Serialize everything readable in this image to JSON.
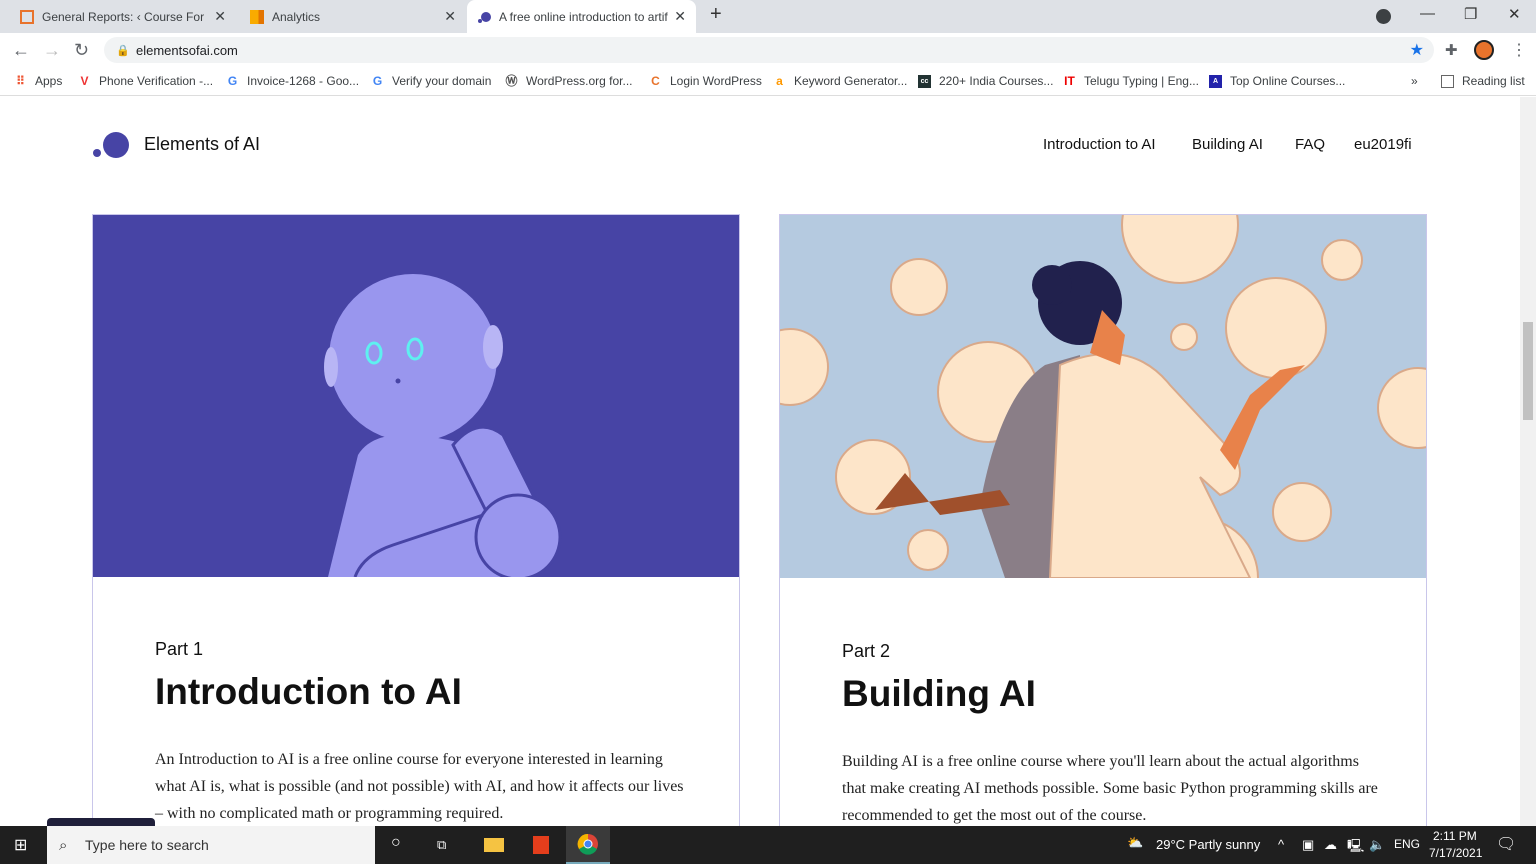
{
  "browser": {
    "tabs": [
      {
        "title": "General Reports: ‹ Course For Futu",
        "icon": "course-favicon"
      },
      {
        "title": "Analytics",
        "icon": "analytics-favicon"
      },
      {
        "title": "A free online introduction to artificial",
        "icon": "elements-favicon",
        "active": true
      }
    ],
    "url": "elementsofai.com",
    "bookmarks": [
      {
        "label": "Apps",
        "icon": "apps-grid-icon"
      },
      {
        "label": "Phone Verification -...",
        "icon": "v-icon"
      },
      {
        "label": "Invoice-1268 - Goo...",
        "icon": "google-icon"
      },
      {
        "label": "Verify your domain",
        "icon": "google-icon"
      },
      {
        "label": "WordPress.org for...",
        "icon": "wordpress-icon"
      },
      {
        "label": "Login WordPress",
        "icon": "course-favicon"
      },
      {
        "label": "Keyword Generator...",
        "icon": "amazon-icon"
      },
      {
        "label": "220+ India Courses...",
        "icon": "cc-icon"
      },
      {
        "label": "Telugu Typing | Eng...",
        "icon": "it-icon"
      },
      {
        "label": "Top Online Courses...",
        "icon": "a-icon"
      }
    ],
    "reading_list": "Reading list",
    "more": "»"
  },
  "site": {
    "brand": "Elements of AI",
    "nav": [
      "Introduction to AI",
      "Building AI",
      "FAQ",
      "eu2019fi"
    ],
    "cards": [
      {
        "part": "Part 1",
        "title": "Introduction to AI",
        "desc": "An Introduction to AI is a free online course for everyone interested in learning what AI is, what is possible (and not possible) with AI, and how it affects our lives – with no complicated math or programming required."
      },
      {
        "part": "Part 2",
        "title": "Building AI",
        "desc": "Building AI is a free online course where you'll learn about the actual algorithms that make creating AI methods possible. Some basic Python programming skills are recommended to get the most out of the course."
      }
    ],
    "colors": {
      "accent": "#4744a5",
      "robot": "#9996ee",
      "card2_bg": "#b5cae0",
      "bubble": "#fde5c9"
    }
  },
  "taskbar": {
    "search_placeholder": "Type here to search",
    "weather": "29°C  Partly sunny",
    "lang": "ENG",
    "time": "2:11 PM",
    "date": "7/17/2021"
  }
}
